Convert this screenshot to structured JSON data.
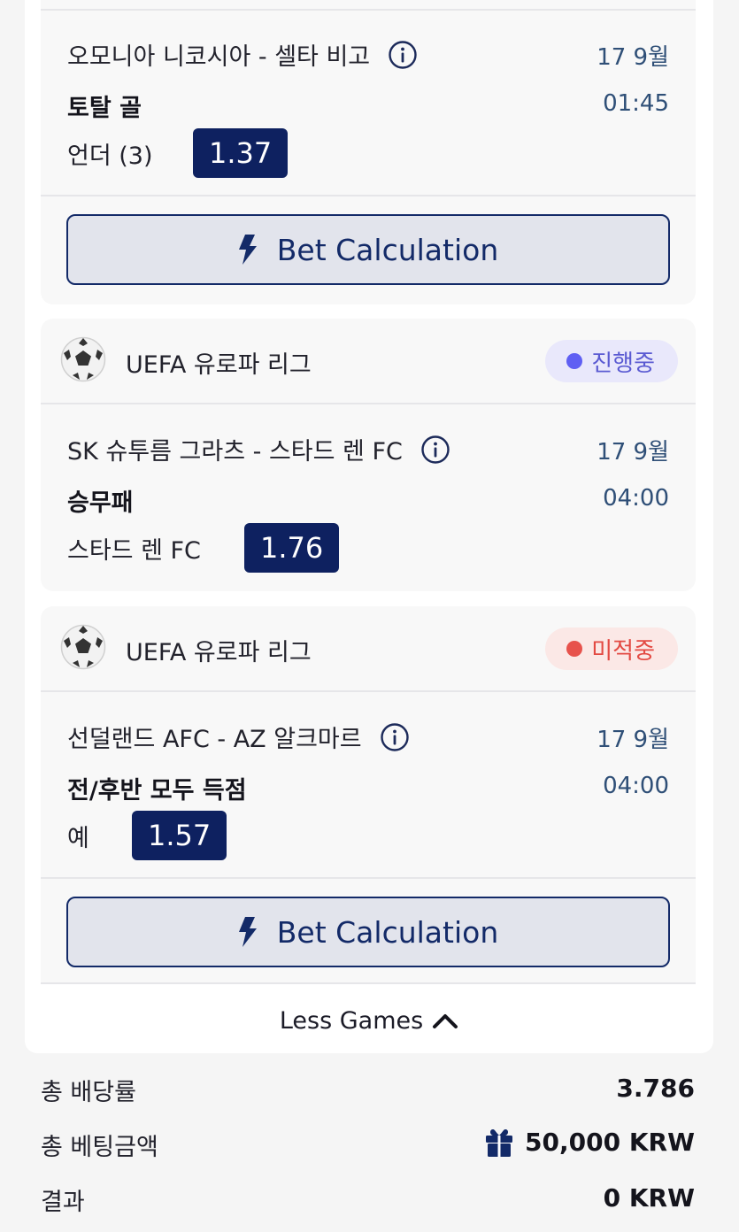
{
  "colors": {
    "navy": "#0e2160",
    "accent_text": "#2f4f77",
    "live": "#5f5ff3",
    "pending": "#e7524c"
  },
  "bet_button_label": "Bet Calculation",
  "bet_button_icon": "lightning-bolt-icon",
  "bets": [
    {
      "match": "오모니아 니코시아 - 셀타 비고",
      "date": "17 9월",
      "time": "01:45",
      "market": "토탈 골",
      "pick": "언더 (3)",
      "odds": "1.37"
    },
    {
      "league": "UEFA 유로파 리그",
      "status": "진행중",
      "match": "SK 슈투름 그라츠 - 스타드 렌 FC",
      "date": "17 9월",
      "time": "04:00",
      "market": "승무패",
      "pick": "스타드 렌 FC",
      "odds": "1.76"
    },
    {
      "league": "UEFA 유로파 리그",
      "status": "미적중",
      "match": "선덜랜드 AFC - AZ 알크마르",
      "date": "17 9월",
      "time": "04:00",
      "market": "전/후반 모두 득점",
      "pick": "예",
      "odds": "1.57"
    }
  ],
  "less_games_label": "Less Games",
  "summary": {
    "total_odds_label": "총 배당률",
    "total_odds_value": "3.786",
    "total_stake_label": "총 베팅금액",
    "total_stake_value": "50,000 KRW",
    "result_label": "결과",
    "result_value": "0 KRW"
  }
}
